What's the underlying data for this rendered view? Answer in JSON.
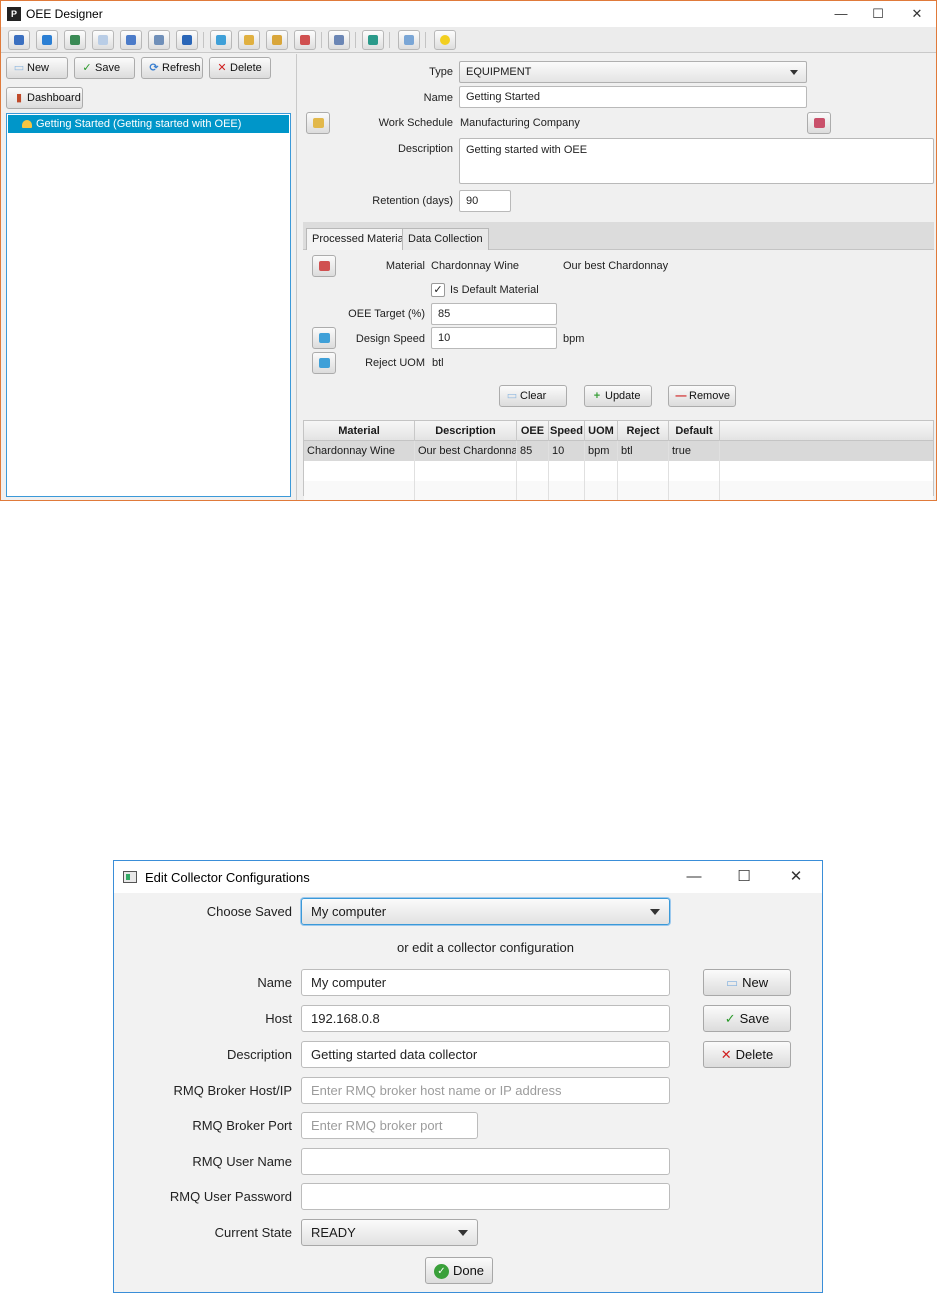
{
  "designer": {
    "title": "OEE Designer",
    "app_icon_letter": "P",
    "window_controls": {
      "minimize": "—",
      "maximize": "☐",
      "close": "✕"
    },
    "toolbar_icons": [
      "physical-model-icon",
      "material-icon",
      "reason-icon",
      "uom-icon",
      "work-schedule-icon",
      "script-icon",
      "collector-icon",
      "import-icon",
      "export-icon",
      "backup-icon",
      "equipment-material-icon",
      "print-icon",
      "dashboard-tool-icon",
      "refresh-tool-icon",
      "help-icon"
    ],
    "actions": {
      "new": "New",
      "save": "Save",
      "refresh": "Refresh",
      "delete": "Delete",
      "dashboard": "Dashboard"
    },
    "tree": {
      "selected_item": "Getting Started (Getting started with OEE)"
    },
    "form": {
      "type_label": "Type",
      "type_value": "EQUIPMENT",
      "name_label": "Name",
      "name_value": "Getting Started",
      "schedule_label": "Work Schedule",
      "schedule_value": "Manufacturing Company",
      "description_label": "Description",
      "description_value": "Getting started with OEE",
      "retention_label": "Retention (days)",
      "retention_value": "90"
    },
    "tabs": [
      "Processed Material",
      "Data Collection"
    ],
    "material_panel": {
      "material_label": "Material",
      "material_value": "Chardonnay Wine",
      "material_desc": "Our best Chardonnay",
      "default_label": "Is Default Material",
      "default_checked": "✓",
      "oee_label": "OEE Target (%)",
      "oee_value": "85",
      "speed_label": "Design Speed",
      "speed_value": "10",
      "speed_unit": "bpm",
      "reject_label": "Reject UOM",
      "reject_value": "btl",
      "clear": "Clear",
      "update": "Update",
      "remove": "Remove"
    },
    "table": {
      "headers": [
        "Material",
        "Description",
        "OEE",
        "Speed",
        "UOM",
        "Reject",
        "Default"
      ],
      "rows": [
        [
          "Chardonnay Wine",
          "Our best Chardonnay",
          "85",
          "10",
          "bpm",
          "btl",
          "true"
        ]
      ]
    },
    "colors": {
      "selection": "#0096c9",
      "frame": "#e07a3a"
    }
  },
  "collector": {
    "title": "Edit Collector Configurations",
    "window_controls": {
      "minimize": "—",
      "maximize": "☐",
      "close": "✕"
    },
    "choose_label": "Choose Saved",
    "choose_value": "My computer",
    "or_edit": "or edit a collector configuration",
    "name_label": "Name",
    "name_value": "My computer",
    "host_label": "Host",
    "host_value": "192.168.0.8",
    "description_label": "Description",
    "description_value": "Getting started data collector",
    "broker_host_label": "RMQ Broker Host/IP",
    "broker_host_placeholder": "Enter RMQ broker host name or IP address",
    "broker_port_label": "RMQ Broker Port",
    "broker_port_placeholder": "Enter RMQ broker port",
    "user_label": "RMQ User Name",
    "password_label": "RMQ User Password",
    "state_label": "Current State",
    "state_value": "READY",
    "new": "New",
    "save": "Save",
    "delete": "Delete",
    "done": "Done",
    "colors": {
      "frame": "#3a8ed8"
    }
  }
}
